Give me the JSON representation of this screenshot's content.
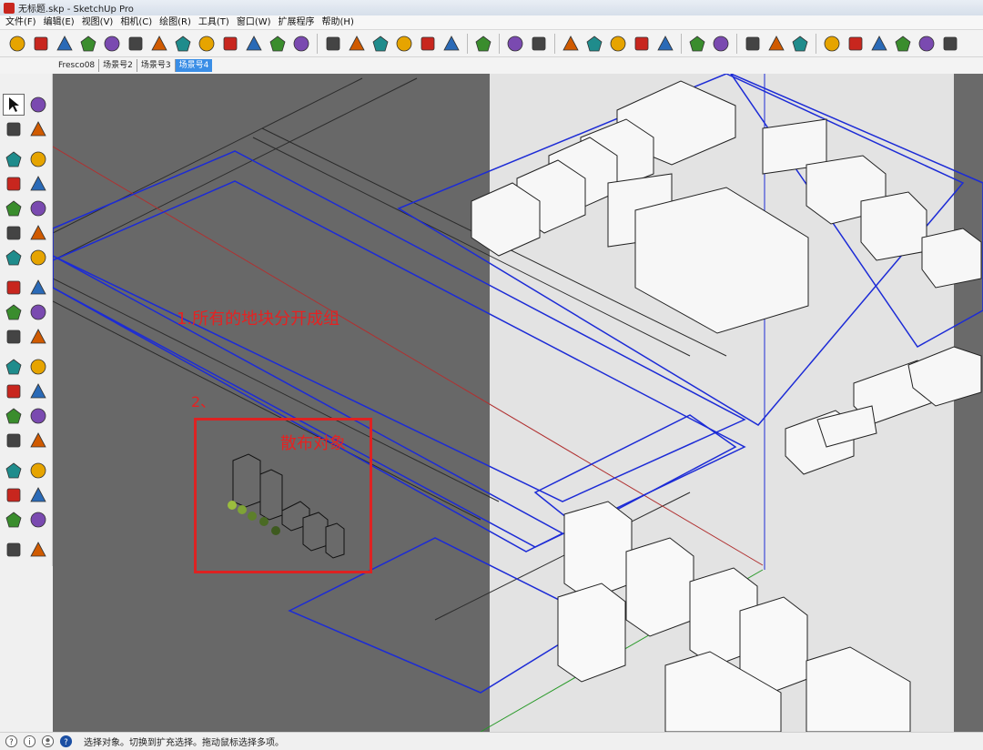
{
  "window": {
    "title": "无标题.skp - SketchUp Pro"
  },
  "menu": [
    "文件(F)",
    "编辑(E)",
    "视图(V)",
    "相机(C)",
    "绘图(R)",
    "工具(T)",
    "窗口(W)",
    "扩展程序",
    "帮助(H)"
  ],
  "scene_tabs": [
    "Fresco08",
    "场景号2",
    "场景号3",
    "场景号4"
  ],
  "active_scene": "场景号4",
  "toolbar_icons": [
    "m-icon",
    "tag-icon",
    "r-icon",
    "rt-icon",
    "br-icon",
    "help-icon",
    "tag2-icon",
    "sphere-icon",
    "brush-icon",
    "tree-icon",
    "tree2-icon",
    "target-icon",
    "chart-icon",
    "dot-icon",
    "lamp-icon",
    "flag-icon",
    "cap-icon",
    "ball-icon",
    "cursor-icon",
    "disabled-icon",
    "rect-select-icon",
    "dashed-select-icon",
    "pinwheel-icon",
    "color-wheel-icon",
    "grid-icon",
    "doc-icon",
    "gear-icon",
    "frame-icon",
    "camera-icon",
    "globe-icon",
    "tree3-icon",
    "tree4-icon",
    "cube-a-icon",
    "cube-b-icon",
    "cube-c-icon",
    "cube-d-icon",
    "cube-e-icon",
    "layers-icon"
  ],
  "left_tools": [
    "select-icon",
    "component-icon",
    "paint-icon",
    "eraser-icon",
    "pencil-icon",
    "freehand-icon",
    "rectangle-icon",
    "rotated-rect-icon",
    "circle-icon",
    "polygon-icon",
    "arc-icon",
    "pie-icon",
    "arc2-icon",
    "arc3-icon",
    "move-icon",
    "pushpull-icon",
    "rotate-icon",
    "followme-icon",
    "scale-icon",
    "offset-icon",
    "tape-icon",
    "dimension-icon",
    "protractor-icon",
    "text-icon",
    "axes-icon",
    "3dtext-icon",
    "orbit-icon",
    "pan-icon",
    "zoom-icon",
    "zoom-window-icon",
    "zoom-extents-icon",
    "previous-icon",
    "walk-icon",
    "lookaround-icon",
    "footprint-icon",
    "section-icon"
  ],
  "annotations": {
    "note1": "1.所有的地块分开成组",
    "note2": "2、",
    "scatter": "散布对象"
  },
  "status": {
    "text": "选择对象。切换到扩充选择。拖动鼠标选择多项。",
    "icons": [
      "info-icon",
      "geo-icon",
      "user-icon",
      "help-icon"
    ]
  },
  "colors": {
    "viewport_bg": "#686868",
    "model_area": "#e3e3e3",
    "annotation": "#e52222",
    "active_tab": "#3a8ee6",
    "guide_blue": "#1c2bd6"
  }
}
